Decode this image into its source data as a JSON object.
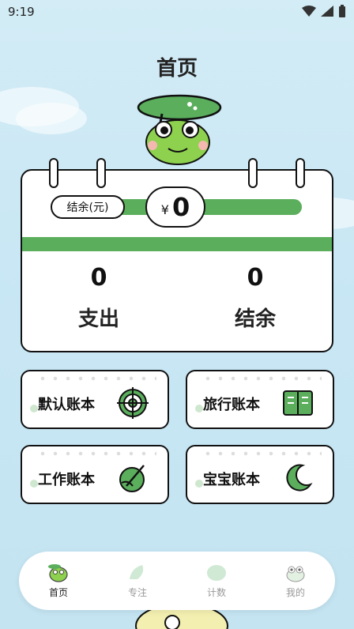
{
  "status": {
    "time": "9:19"
  },
  "header": {
    "title": "首页"
  },
  "card": {
    "balance_label": "结余(元)",
    "currency": "¥",
    "balance": "0",
    "expense_value": "0",
    "expense_label": "支出",
    "surplus_value": "0",
    "surplus_label": "结余"
  },
  "books": [
    {
      "label": "默认账本",
      "icon": "target-icon"
    },
    {
      "label": "旅行账本",
      "icon": "book-icon"
    },
    {
      "label": "工作账本",
      "icon": "pen-circle-icon"
    },
    {
      "label": "宝宝账本",
      "icon": "moon-icon"
    }
  ],
  "tabs": [
    {
      "label": "首页",
      "icon": "frog-home-icon",
      "active": true
    },
    {
      "label": "专注",
      "icon": "focus-icon",
      "active": false
    },
    {
      "label": "计数",
      "icon": "count-icon",
      "active": false
    },
    {
      "label": "我的",
      "icon": "frog-face-icon",
      "active": false
    }
  ],
  "colors": {
    "accent": "#5aae5c",
    "background": "#c9e7f4"
  }
}
